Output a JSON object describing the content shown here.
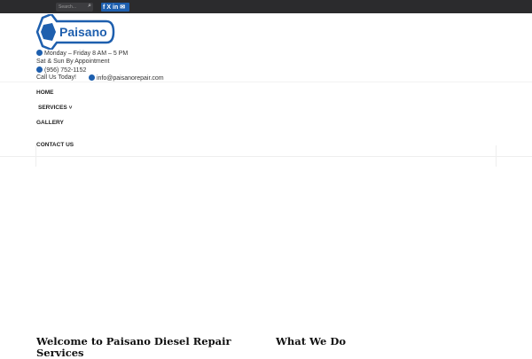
{
  "topbar": {
    "search_placeholder": "Search...",
    "social": [
      "f",
      "X",
      "in",
      "✉"
    ]
  },
  "logo": {
    "text": "Paisano"
  },
  "info": {
    "hours": "Monday – Friday 8 AM – 5 PM",
    "weekend": "Sat & Sun By Appointment",
    "phone": "(956) 752-1152",
    "call": "Call Us Today!",
    "email": "info@paisanorepair.com"
  },
  "nav": {
    "home": "HOME",
    "services": "SERVICES",
    "gallery": "GALLERY",
    "contact": "CONTACT US"
  },
  "sections": {
    "welcome": "Welcome to Paisano Diesel Repair Services",
    "what": "What We Do"
  }
}
